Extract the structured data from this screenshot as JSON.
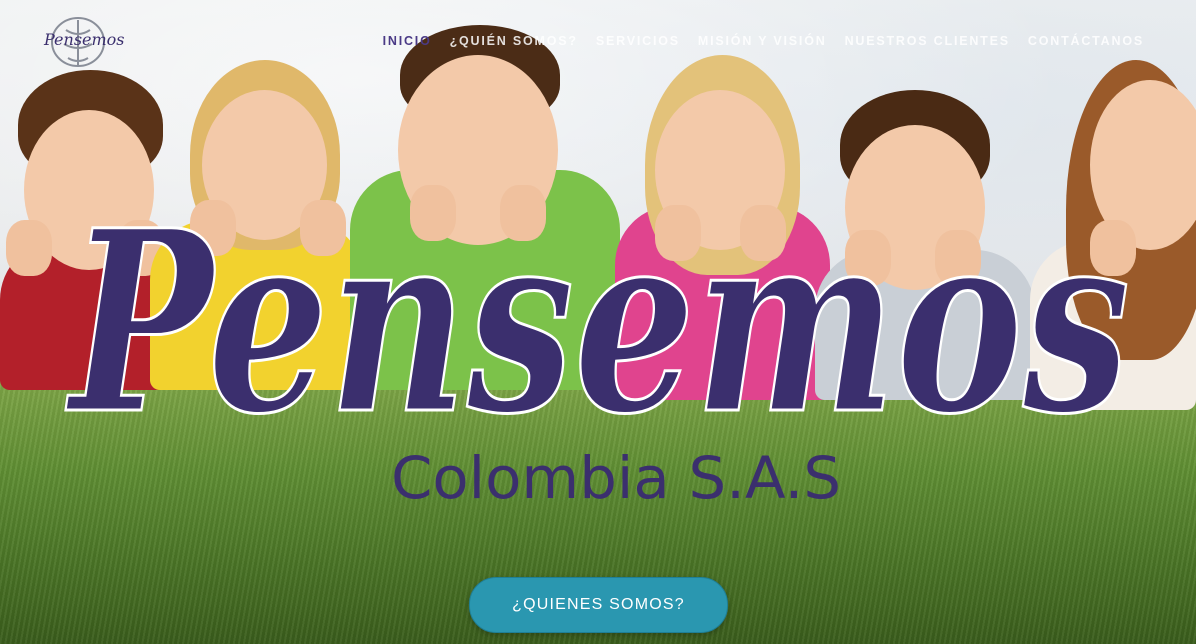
{
  "nav": {
    "items": [
      {
        "label": "INICIO",
        "active": true
      },
      {
        "label": "¿QUIÉN SOMOS?",
        "active": false
      },
      {
        "label": "SERVICIOS",
        "active": false
      },
      {
        "label": "MISIÓN Y VISIÓN",
        "active": false
      },
      {
        "label": "NUESTROS CLIENTES",
        "active": false
      },
      {
        "label": "CONTÁCTANOS",
        "active": false
      }
    ]
  },
  "logo": {
    "text": "Pensemos",
    "icon": "brain-tree-icon"
  },
  "hero": {
    "brand_name": "Pensemos",
    "brand_sub": "Colombia S.A.S",
    "cta_label": "¿QUIENES SOMOS?"
  },
  "colors": {
    "brand_purple": "#3b2f6e",
    "active_nav": "#4a3a86",
    "cta_bg": "#2a97b0"
  }
}
